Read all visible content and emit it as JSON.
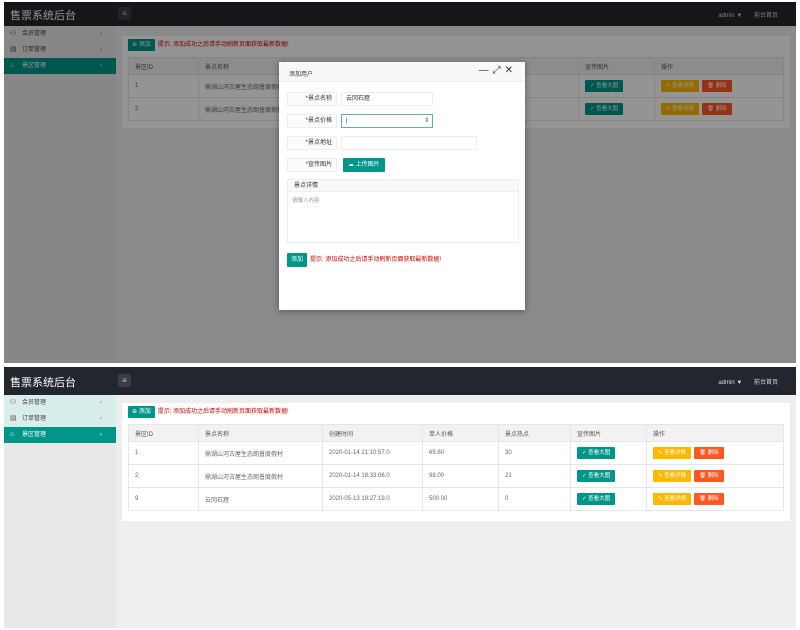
{
  "app": {
    "title": "售票系统后台",
    "user": "admin",
    "user_caret": "▼",
    "front_link": "前台首页"
  },
  "sidebar": {
    "items": [
      {
        "label": "会员管理",
        "icon": "user-icon",
        "glyph": "⚇",
        "active": false
      },
      {
        "label": "订单管理",
        "icon": "order-icon",
        "glyph": "▤",
        "active": false
      },
      {
        "label": "景区管理",
        "icon": "scenic-icon",
        "glyph": "⌂",
        "active": true
      }
    ],
    "chevron": "‹"
  },
  "toolbar": {
    "add_label": "⊕ 添加",
    "tip": "提示: 添加成功之后请手动刷新页面获取最新数据!"
  },
  "table": {
    "headers_full": [
      "景区ID",
      "景点名称",
      "创建时间",
      "单人价格",
      "景点热点",
      "宣传图片",
      "操作"
    ],
    "headers_partial": [
      "景区ID",
      "景点名称",
      "宣传图片",
      "操作"
    ],
    "rows": [
      {
        "id": "1",
        "name": "鼎湖山河古屋生态朗普度假村",
        "created": "2020-01-14 21:10:57.0",
        "price": "69.60",
        "hot": "30"
      },
      {
        "id": "2",
        "name": "鼎湖山河古屋生态朗普度假村",
        "created": "2020-01-14 18:33:06.0",
        "price": "98.00",
        "hot": "21"
      },
      {
        "id": "9",
        "name": "云冈石窟",
        "created": "2020-05-13 19:27:19.0",
        "price": "500.00",
        "hot": "0"
      }
    ],
    "view_image": "✓ 查看大图",
    "view_detail": "✎ 查看详情",
    "delete": "🗑 删除"
  },
  "modal": {
    "title": "添加用户",
    "minimize": "—",
    "maximize": "⤢",
    "close": "✕",
    "name_label": "*景点名称",
    "name_value": "云冈石窟",
    "price_label": "*景点价格",
    "price_value": "|",
    "address_label": "*景点地址",
    "address_value": "",
    "image_label": "*宣传图片",
    "upload_label": "☁ 上传图片",
    "detail_label": "景点详情",
    "detail_placeholder": "请输入内容",
    "submit_label": "添加",
    "tip": "提示: 添加成功之后请手动刷新页面获取最新数据!"
  }
}
